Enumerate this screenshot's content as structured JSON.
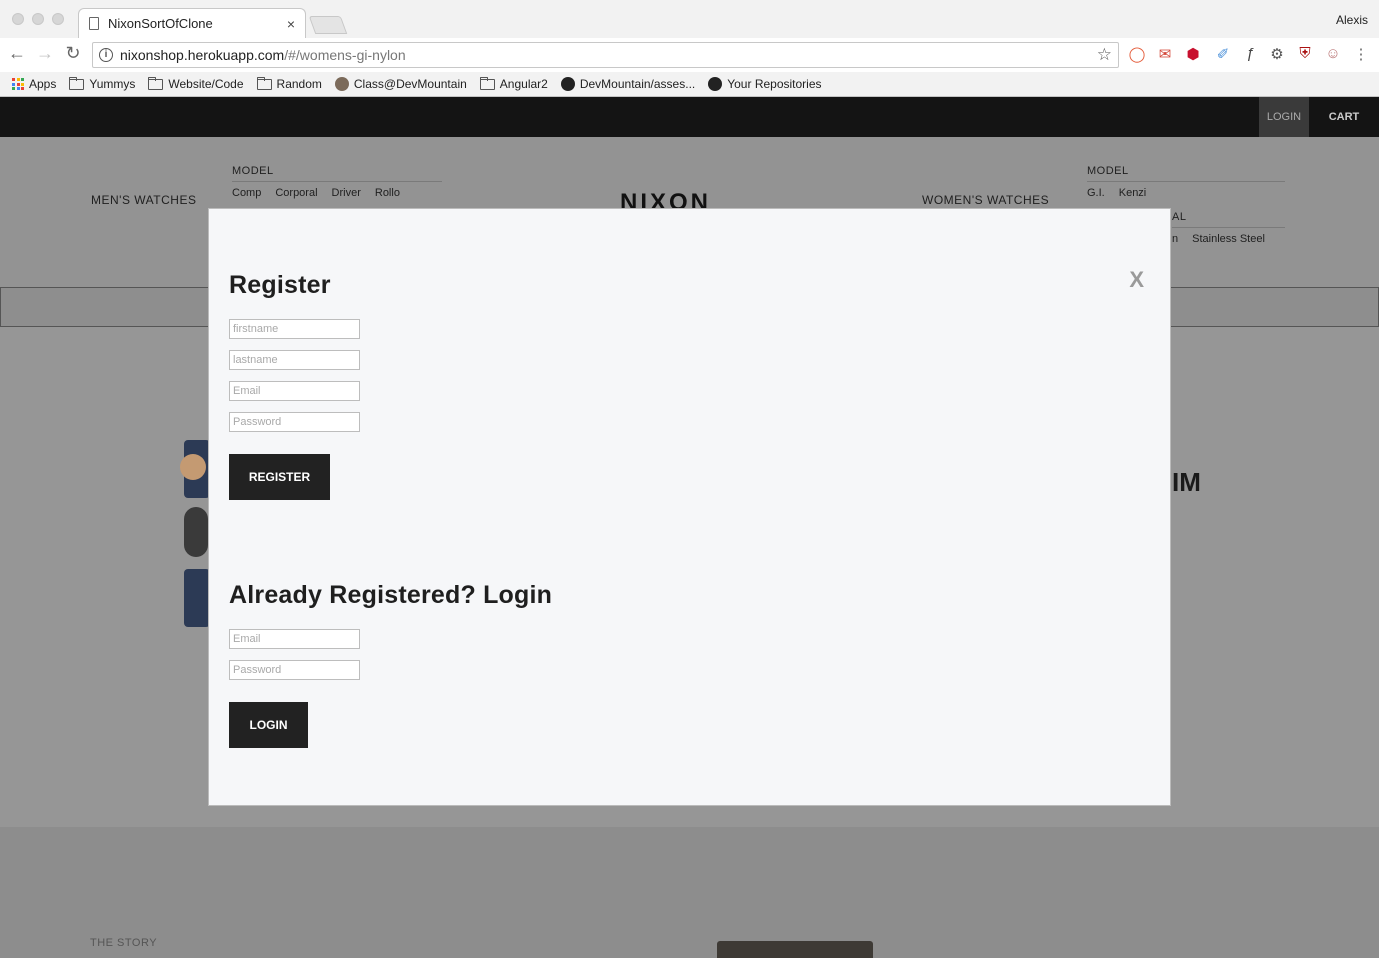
{
  "browser": {
    "tab_title": "NixonSortOfClone",
    "tab_close": "×",
    "user": "Alexis",
    "url_host": "nixonshop.herokuapp.com",
    "url_path": "/#/womens-gi-nylon",
    "bookmarks": [
      {
        "label": "Apps",
        "icon": "apps-grid-icon"
      },
      {
        "label": "Yummys",
        "icon": "folder-icon"
      },
      {
        "label": "Website/Code",
        "icon": "folder-icon"
      },
      {
        "label": "Random",
        "icon": "folder-icon"
      },
      {
        "label": "Class@DevMountain",
        "icon": "owl-icon"
      },
      {
        "label": "Angular2",
        "icon": "folder-icon"
      },
      {
        "label": "DevMountain/asses...",
        "icon": "github-icon"
      },
      {
        "label": "Your Repositories",
        "icon": "github-icon"
      }
    ]
  },
  "site": {
    "topbar": {
      "login": "LOGIN",
      "cart": "CART"
    },
    "nav": {
      "mens": "MEN'S WATCHES",
      "womens": "WOMEN'S WATCHES",
      "mens_model_header": "MODEL",
      "mens_models": [
        "Comp",
        "Corporal",
        "Driver",
        "Rollo"
      ],
      "womens_model_header": "MODEL",
      "womens_models": [
        "G.I.",
        "Kenzi"
      ],
      "womens_material_fragment": "AL",
      "womens_materials_fragment": [
        "n",
        "Stainless Steel"
      ]
    },
    "logo": "NIXON",
    "hero_fragment": "IM",
    "story": "THE STORY"
  },
  "modal": {
    "close": "X",
    "register": {
      "title": "Register",
      "firstname_placeholder": "firstname",
      "lastname_placeholder": "lastname",
      "email_placeholder": "Email",
      "password_placeholder": "Password",
      "button": "REGISTER"
    },
    "login": {
      "title": "Already Registered? Login",
      "email_placeholder": "Email",
      "password_placeholder": "Password",
      "button": "LOGIN"
    }
  }
}
